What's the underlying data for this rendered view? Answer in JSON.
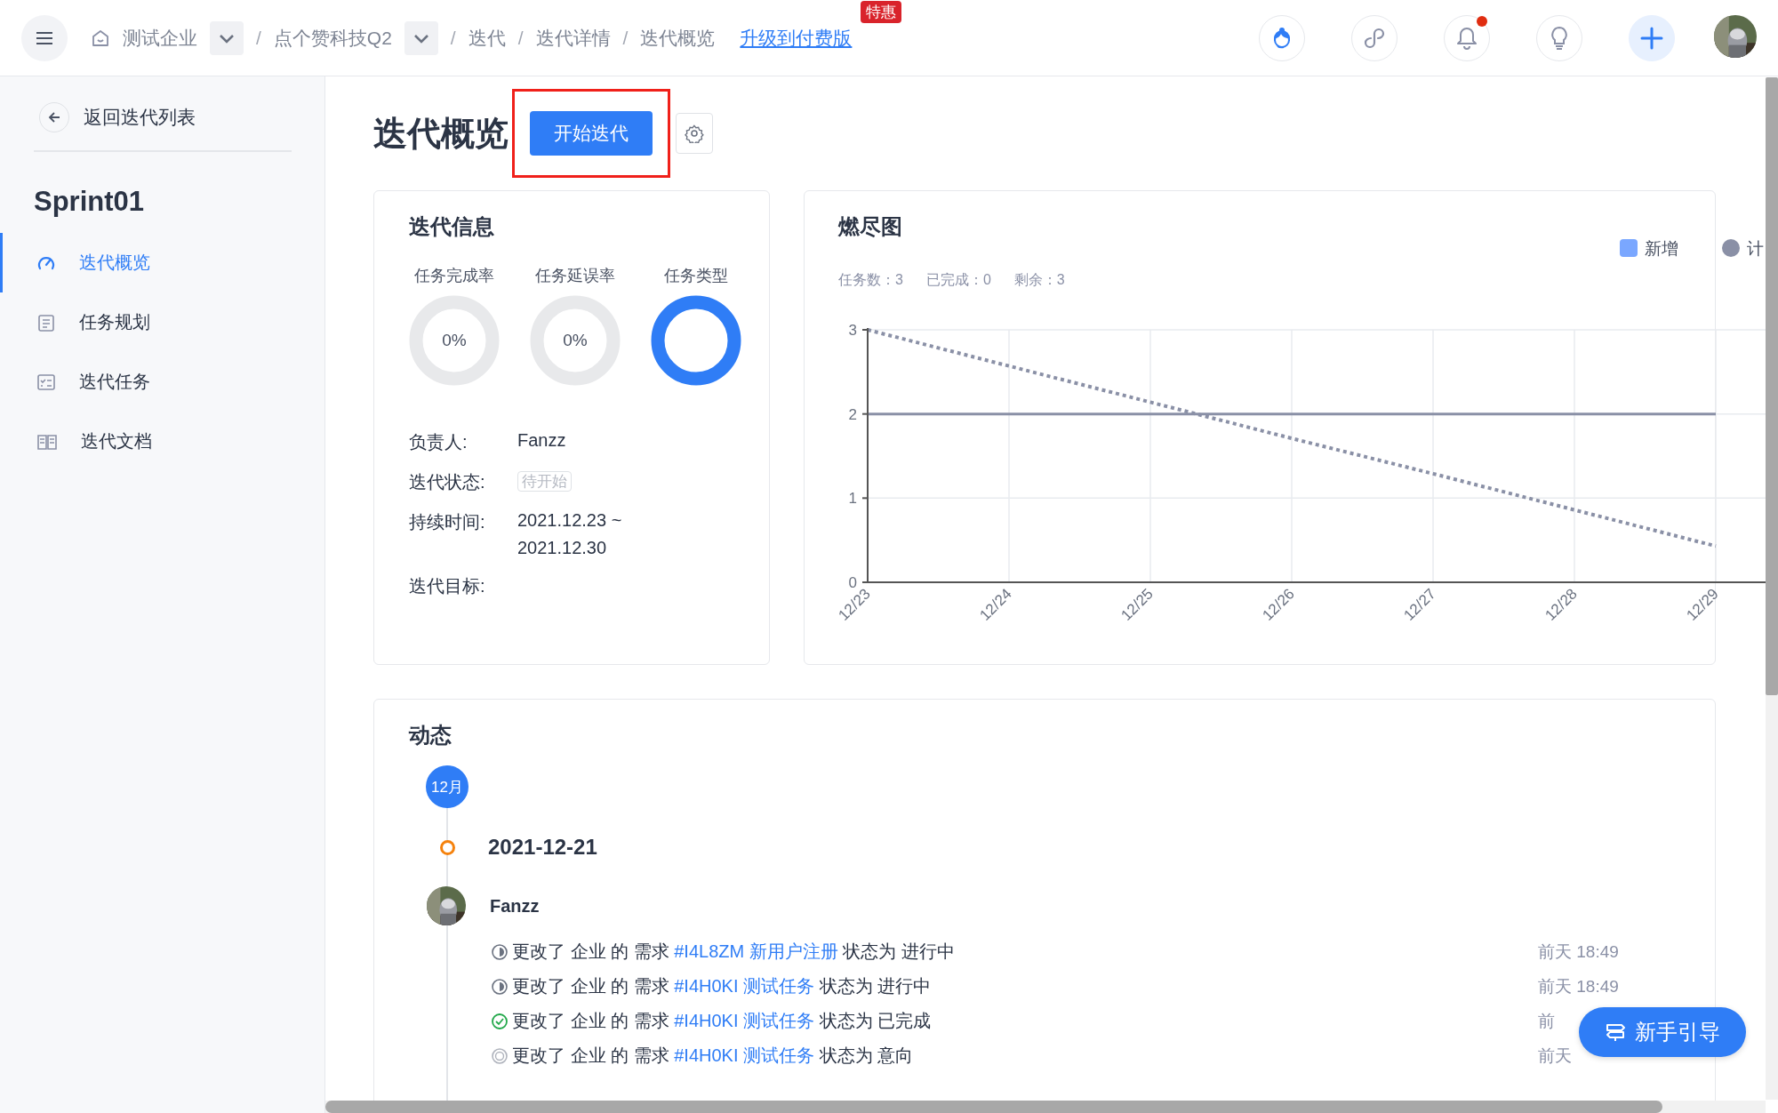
{
  "topbar": {
    "breadcrumb": [
      {
        "label": "测试企业",
        "kind": "home",
        "dropdown": true
      },
      {
        "separator": "/",
        "label": "点个赞科技Q2",
        "kind": "plain",
        "dropdown": true
      },
      {
        "separator": "/",
        "label": "迭代",
        "kind": "plain",
        "dropdown": false
      },
      {
        "separator": "/",
        "label": "迭代详情",
        "kind": "plain",
        "dropdown": false
      },
      {
        "separator": "/",
        "label": "迭代概览",
        "kind": "plain",
        "dropdown": false
      }
    ],
    "upgrade_link": "升级到付费版",
    "upgrade_badge": "特惠",
    "actions": [
      {
        "kind": "support",
        "badge": false
      },
      {
        "kind": "link",
        "badge": false
      },
      {
        "kind": "bell",
        "badge": true
      },
      {
        "kind": "bulb",
        "badge": false
      },
      {
        "kind": "plus",
        "badge": false
      }
    ]
  },
  "sidebar": {
    "back": "返回迭代列表",
    "title": "Sprint01",
    "items": [
      {
        "label": "迭代概览",
        "kind": "gauge",
        "selected": true
      },
      {
        "label": "任务规划",
        "kind": "plan",
        "selected": false
      },
      {
        "label": "迭代任务",
        "kind": "task",
        "selected": false
      },
      {
        "label": "迭代文档",
        "kind": "doc",
        "selected": false
      }
    ]
  },
  "page": {
    "title": "迭代概览",
    "start_button": "开始迭代",
    "highlighted": true
  },
  "info": {
    "title": "迭代信息",
    "rings": [
      {
        "label": "任务完成率",
        "value": "0%",
        "kind": "percent"
      },
      {
        "label": "任务延误率",
        "value": "0%",
        "kind": "percent"
      },
      {
        "label": "任务类型",
        "kind": "pie"
      }
    ],
    "fields": [
      {
        "label": "负责人:",
        "kind": "text",
        "value": "Fanzz"
      },
      {
        "label": "迭代状态:",
        "kind": "tag",
        "value": "待开始"
      },
      {
        "label": "持续时间:",
        "kind": "lines",
        "lines": [
          "2021.12.23 ~",
          "2021.12.30"
        ]
      },
      {
        "label": "迭代目标:",
        "kind": "text"
      }
    ]
  },
  "burndown": {
    "title": "燃尽图",
    "stats": [
      "任务数：3",
      "已完成：0",
      "剩余：3"
    ],
    "chart_data": {
      "type": "line",
      "grid": true,
      "categories": [
        "12/23",
        "12/24",
        "12/25",
        "12/26",
        "12/27",
        "12/28",
        "12/29"
      ],
      "ylim": [
        0,
        3
      ],
      "yticks": [
        0,
        1,
        2,
        3
      ],
      "series": [
        {
          "name": "新增",
          "color": "#7aa7ff",
          "values": [
            null,
            null,
            null,
            null,
            null,
            null,
            null
          ]
        },
        {
          "name": "计",
          "color": "#8a90a6",
          "line_style": "dotted",
          "values": [
            3,
            2.57,
            2.14,
            1.71,
            1.29,
            0.86,
            0.43
          ]
        },
        {
          "color": "#8a90a6",
          "values": [
            2,
            2,
            2,
            2,
            2,
            2,
            2
          ]
        }
      ]
    }
  },
  "activity": {
    "title": "动态",
    "month": "12月",
    "days": [
      {
        "date": "2021-12-21",
        "user": "Fanzz",
        "entries": [
          {
            "kind": "progress",
            "prefix": "更改了 企业 的 需求",
            "link": "#I4L8ZM 新用户注册",
            "suffix": "状态为 进行中",
            "time": "前天 18:49"
          },
          {
            "kind": "progress",
            "prefix": "更改了 企业 的 需求",
            "link": "#I4H0KI 测试任务",
            "suffix": "状态为 进行中",
            "time": "前天 18:49"
          },
          {
            "kind": "done",
            "prefix": "更改了 企业 的 需求",
            "link": "#I4H0KI 测试任务",
            "suffix": "状态为 已完成",
            "time": "前"
          },
          {
            "kind": "intent",
            "prefix": "更改了 企业 的 需求",
            "link": "#I4H0KI 测试任务",
            "suffix": "状态为 意向",
            "time": "前天"
          }
        ]
      }
    ]
  },
  "guide_button": "新手引导"
}
